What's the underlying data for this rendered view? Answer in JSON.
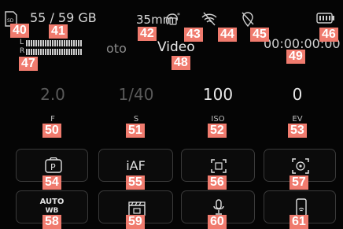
{
  "status": {
    "storage": "55 / 59 GB",
    "focal_length": "35mm",
    "timecode": "00:00:00:00"
  },
  "level": {
    "left_channel": "L",
    "right_channel": "R"
  },
  "modes": {
    "photo": "oto",
    "video": "Video"
  },
  "exposure": [
    {
      "value": "2.0",
      "label": "F"
    },
    {
      "value": "1/40",
      "label": "S"
    },
    {
      "value": "100",
      "label": "ISO"
    },
    {
      "value": "0",
      "label": "EV"
    }
  ],
  "tiles": {
    "exposure_mode": "P",
    "focus_mode": "iAF",
    "wb_line1": "AUTO",
    "wb_line2": "WB"
  },
  "markers": [
    "40",
    "41",
    "42",
    "43",
    "44",
    "45",
    "46",
    "47",
    "48",
    "49",
    "50",
    "51",
    "52",
    "53",
    "54",
    "55",
    "56",
    "57",
    "58",
    "59",
    "60",
    "61"
  ],
  "colors": {
    "background": "#050505",
    "marker": "#f07b6e",
    "text": "#e0e0e0",
    "tile_border": "#3a3a3a"
  }
}
